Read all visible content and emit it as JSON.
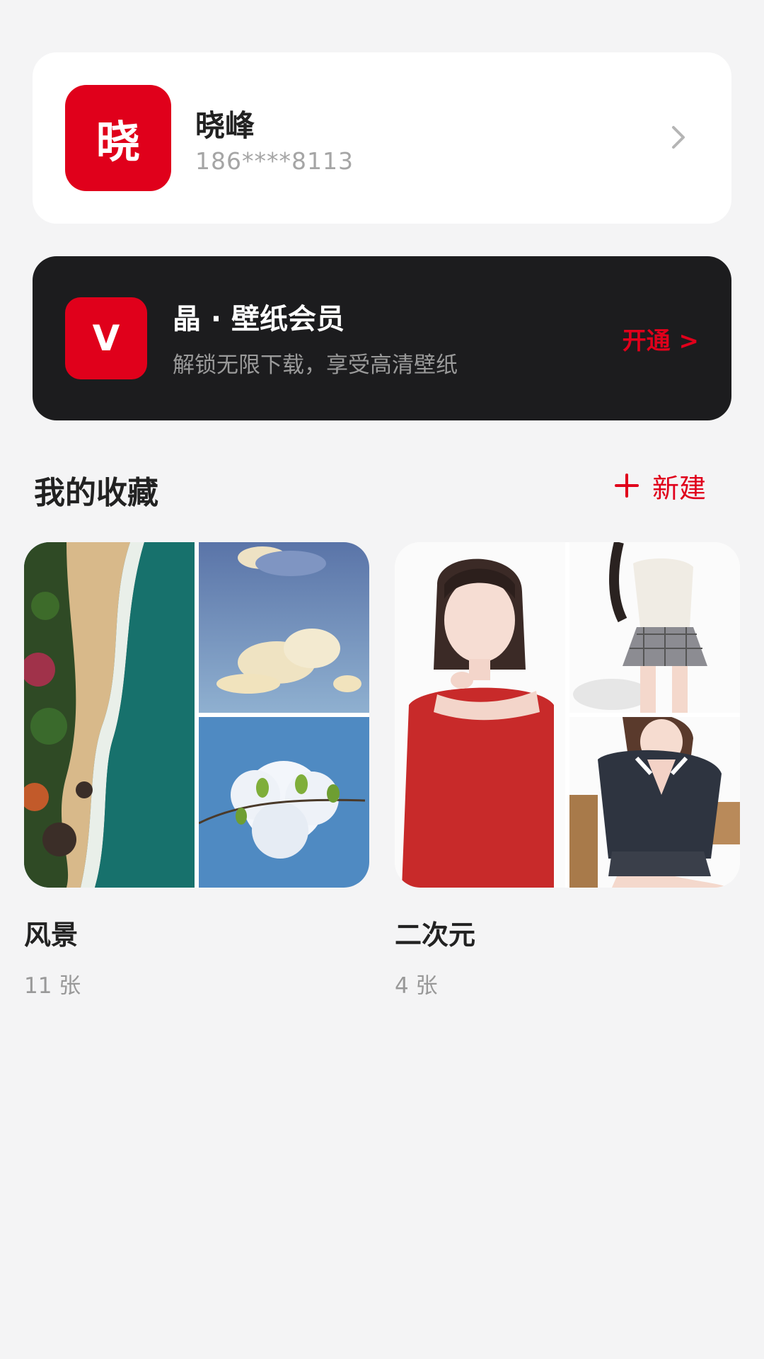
{
  "profile": {
    "avatar_text": "晓",
    "name": "晓峰",
    "phone": "186****8113"
  },
  "vip": {
    "badge_text": "V",
    "title": "晶 · 壁纸会员",
    "subtitle": "解锁无限下载，享受高清壁纸",
    "action_label": "开通 >"
  },
  "favorites": {
    "title": "我的收藏",
    "new_label": "新建",
    "albums": [
      {
        "name": "风景",
        "count": "11 张",
        "thumbnails": [
          "aerial-beach-photo",
          "sky-clouds-photo",
          "cloud-branch-photo"
        ]
      },
      {
        "name": "二次元",
        "count": "4 张",
        "thumbnails": [
          "anime-girl-red-sweater",
          "anime-girl-plaid-skirt",
          "anime-girl-school-uniform"
        ]
      }
    ]
  },
  "colors": {
    "accent": "#e0001b",
    "background": "#f4f4f5",
    "vip_card": "#1c1c1e"
  }
}
